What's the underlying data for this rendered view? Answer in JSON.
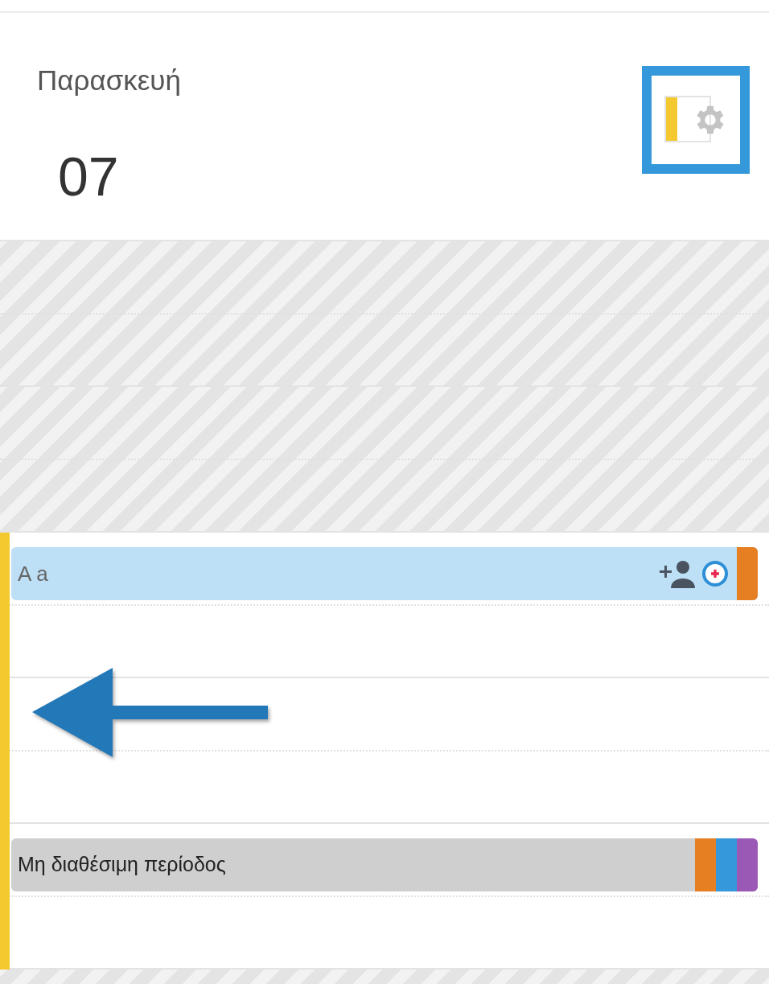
{
  "day": {
    "name": "Παρασκευή",
    "number": "07"
  },
  "availability_toggle": {
    "on": true,
    "highlighted": true
  },
  "hours": [
    {
      "kind": "unavailable"
    },
    {
      "kind": "unavailable"
    },
    {
      "kind": "open",
      "first_half": {
        "title": "A a",
        "kind": "appointment",
        "color": "#bde0f7",
        "tags": [
          {
            "color": "#e67e22"
          }
        ]
      }
    },
    {
      "kind": "open"
    },
    {
      "kind": "open",
      "first_half": {
        "title": "Μη διαθέσιμη περίοδος",
        "kind": "blocked",
        "color": "#cfcfcf",
        "tags": [
          {
            "color": "#e67e22"
          },
          {
            "color": "#3498db"
          },
          {
            "color": "#9b59b6"
          }
        ]
      }
    },
    {
      "kind": "unavailable"
    }
  ],
  "pointer_arrow": {
    "shown": true
  }
}
